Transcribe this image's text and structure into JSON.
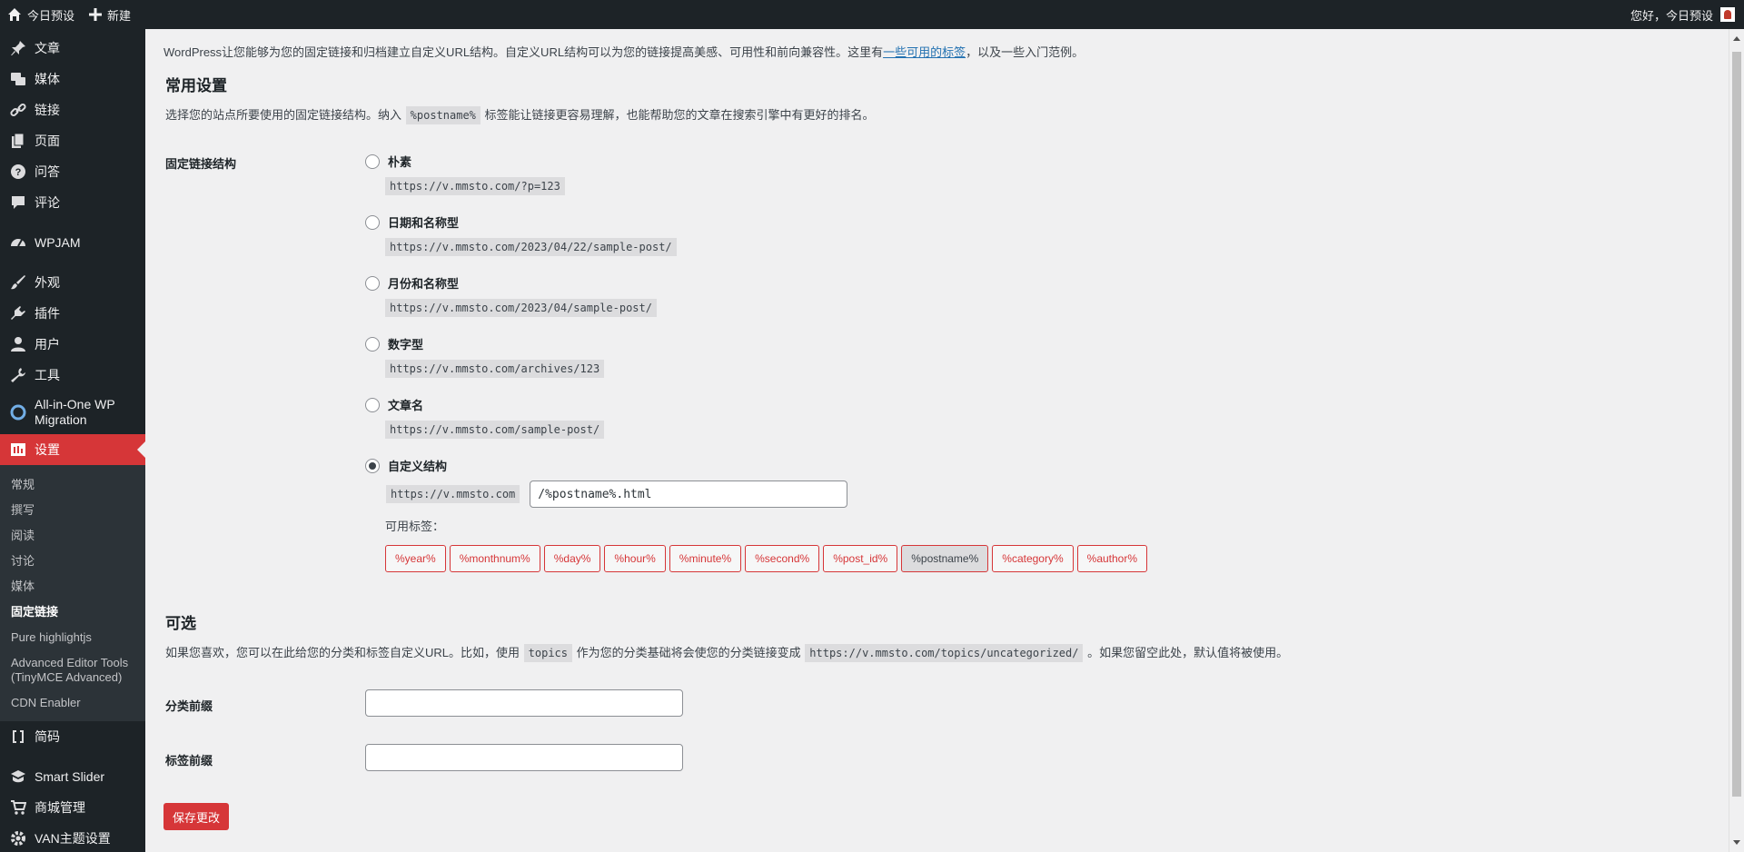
{
  "adminbar": {
    "site_name": "今日预设",
    "new_label": "新建",
    "greeting": "您好，今日预设"
  },
  "sidebar": {
    "items": [
      {
        "label": "文章",
        "icon": "pin-icon"
      },
      {
        "label": "媒体",
        "icon": "media-icon"
      },
      {
        "label": "链接",
        "icon": "link-icon"
      },
      {
        "label": "页面",
        "icon": "page-icon"
      },
      {
        "label": "问答",
        "icon": "help-icon"
      },
      {
        "label": "评论",
        "icon": "comment-icon"
      },
      {
        "label": "WPJAM",
        "icon": "dashboard-icon"
      },
      {
        "label": "外观",
        "icon": "brush-icon"
      },
      {
        "label": "插件",
        "icon": "plugin-icon"
      },
      {
        "label": "用户",
        "icon": "user-icon"
      },
      {
        "label": "工具",
        "icon": "wrench-icon"
      },
      {
        "label": "All-in-One WP Migration",
        "icon": "migration-icon"
      },
      {
        "label": "设置",
        "icon": "settings-icon"
      }
    ],
    "submenu": [
      "常规",
      "撰写",
      "阅读",
      "讨论",
      "媒体",
      "固定链接",
      "Pure highlightjs",
      "Advanced Editor Tools (TinyMCE Advanced)",
      "CDN Enabler"
    ],
    "after": [
      {
        "label": "简码",
        "icon": "shortcode-icon"
      },
      {
        "label": "Smart Slider",
        "icon": "slider-icon"
      },
      {
        "label": "商城管理",
        "icon": "cart-icon"
      },
      {
        "label": "VAN主题设置",
        "icon": "gear-icon"
      }
    ]
  },
  "main": {
    "intro_before": "WordPress让您能够为您的固定链接和归档建立自定义URL结构。自定义URL结构可以为您的链接提高美感、可用性和前向兼容性。这里有",
    "intro_link": "一些可用的标签",
    "intro_after": "，以及一些入门范例。",
    "common_title": "常用设置",
    "common_desc_before": "选择您的站点所要使用的固定链接结构。纳入",
    "common_desc_code": "%postname%",
    "common_desc_after": "标签能让链接更容易理解，也能帮助您的文章在搜索引擎中有更好的排名。",
    "structure_label": "固定链接结构",
    "options": [
      {
        "label": "朴素",
        "url": "https://v.mmsto.com/?p=123",
        "checked": false
      },
      {
        "label": "日期和名称型",
        "url": "https://v.mmsto.com/2023/04/22/sample-post/",
        "checked": false
      },
      {
        "label": "月份和名称型",
        "url": "https://v.mmsto.com/2023/04/sample-post/",
        "checked": false
      },
      {
        "label": "数字型",
        "url": "https://v.mmsto.com/archives/123",
        "checked": false
      },
      {
        "label": "文章名",
        "url": "https://v.mmsto.com/sample-post/",
        "checked": false
      },
      {
        "label": "自定义结构",
        "checked": true
      }
    ],
    "custom_base": "https://v.mmsto.com",
    "custom_value": "/%postname%.html",
    "available_tags_label": "可用标签：",
    "tags": [
      "%year%",
      "%monthnum%",
      "%day%",
      "%hour%",
      "%minute%",
      "%second%",
      "%post_id%",
      "%postname%",
      "%category%",
      "%author%"
    ],
    "active_tag": "%postname%",
    "optional_title": "可选",
    "optional_desc_before": "如果您喜欢，您可以在此给您的分类和标签自定义URL。比如，使用",
    "optional_desc_code1": "topics",
    "optional_desc_mid": "作为您的分类基础将会使您的分类链接变成",
    "optional_desc_code2": "https://v.mmsto.com/topics/uncategorized/",
    "optional_desc_after": "。如果您留空此处，默认值将被使用。",
    "category_base_label": "分类前缀",
    "category_base_value": "",
    "tag_base_label": "标签前缀",
    "tag_base_value": "",
    "save_label": "保存更改"
  },
  "colors": {
    "accent": "#d63638",
    "adminbar": "#1d2327",
    "background": "#f0f0f1"
  }
}
